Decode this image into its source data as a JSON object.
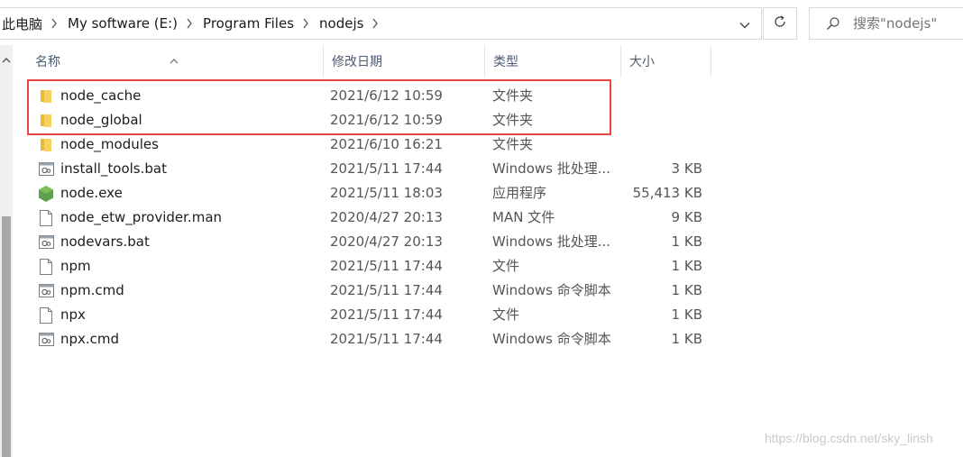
{
  "address_bar": {
    "crumbs": [
      "此电脑",
      "My software (E:)",
      "Program Files",
      "nodejs"
    ]
  },
  "search": {
    "placeholder": "搜索\"nodejs\""
  },
  "columns": {
    "name": "名称",
    "date": "修改日期",
    "type": "类型",
    "size": "大小"
  },
  "files": [
    {
      "name": "node_cache",
      "date": "2021/6/12 10:59",
      "type": "文件夹",
      "size": "",
      "icon": "folder-icon"
    },
    {
      "name": "node_global",
      "date": "2021/6/12 10:59",
      "type": "文件夹",
      "size": "",
      "icon": "folder-icon"
    },
    {
      "name": "node_modules",
      "date": "2021/6/10 16:21",
      "type": "文件夹",
      "size": "",
      "icon": "folder-icon"
    },
    {
      "name": "install_tools.bat",
      "date": "2021/5/11 17:44",
      "type": "Windows 批处理...",
      "size": "3 KB",
      "icon": "batch-file-icon"
    },
    {
      "name": "node.exe",
      "date": "2021/5/11 18:03",
      "type": "应用程序",
      "size": "55,413 KB",
      "icon": "nodejs-icon"
    },
    {
      "name": "node_etw_provider.man",
      "date": "2020/4/27 20:13",
      "type": "MAN 文件",
      "size": "9 KB",
      "icon": "file-icon"
    },
    {
      "name": "nodevars.bat",
      "date": "2020/4/27 20:13",
      "type": "Windows 批处理...",
      "size": "1 KB",
      "icon": "batch-file-icon"
    },
    {
      "name": "npm",
      "date": "2021/5/11 17:44",
      "type": "文件",
      "size": "1 KB",
      "icon": "file-icon"
    },
    {
      "name": "npm.cmd",
      "date": "2021/5/11 17:44",
      "type": "Windows 命令脚本",
      "size": "1 KB",
      "icon": "batch-file-icon"
    },
    {
      "name": "npx",
      "date": "2021/5/11 17:44",
      "type": "文件",
      "size": "1 KB",
      "icon": "file-icon"
    },
    {
      "name": "npx.cmd",
      "date": "2021/5/11 17:44",
      "type": "Windows 命令脚本",
      "size": "1 KB",
      "icon": "batch-file-icon"
    }
  ],
  "watermark": "https://blog.csdn.net/sky_linsh",
  "colors": {
    "highlight": "#e24646",
    "folder": "#f5c542"
  }
}
